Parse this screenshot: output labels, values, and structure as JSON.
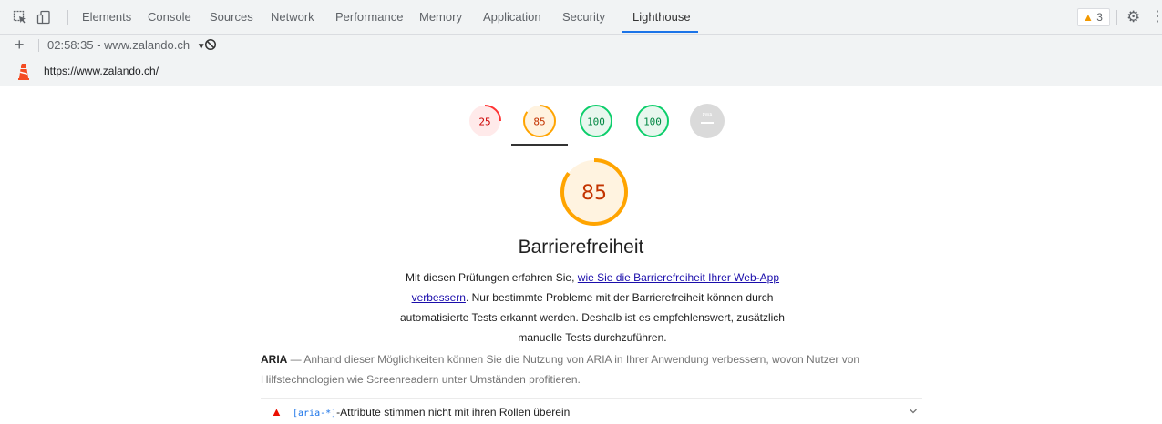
{
  "devtools": {
    "tabs": [
      "Elements",
      "Console",
      "Sources",
      "Network",
      "Performance",
      "Memory",
      "Application",
      "Security",
      "Lighthouse"
    ],
    "active_tab": "Lighthouse",
    "warning_count": "3",
    "icons": [
      "inspect-element-icon",
      "device-toolbar-icon",
      "warning-icon",
      "gear-icon",
      "kebab-menu-icon"
    ]
  },
  "report_bar": {
    "selected_report": "02:58:35 - www.zalando.ch",
    "icons": [
      "plus-icon",
      "dropdown-caret-icon",
      "clear-block-icon"
    ]
  },
  "url_bar": {
    "url": "https://www.zalando.ch/",
    "icon": "lighthouse-icon"
  },
  "scores": [
    {
      "value": "25",
      "status": "fail",
      "color": "#ff3333"
    },
    {
      "value": "85",
      "status": "average",
      "color": "#ffa400",
      "selected": true
    },
    {
      "value": "100",
      "status": "pass",
      "color": "#0cce6b"
    },
    {
      "value": "100",
      "status": "pass",
      "color": "#0cce6b"
    },
    {
      "value": "PWA",
      "status": "na",
      "color": "#bdbdbd"
    }
  ],
  "category": {
    "score": "85",
    "score_fraction": 0.85,
    "title": "Barrierefreiheit",
    "desc_before": "Mit diesen Prüfungen erfahren Sie, ",
    "desc_link": "wie Sie die Barrierefreiheit Ihrer Web-App verbessern",
    "desc_after": ". Nur bestimmte Probleme mit der Barrierefreiheit können durch automatisierte Tests erkannt werden. Deshalb ist es empfehlenswert, zusätzlich manuelle Tests durchzuführen."
  },
  "group": {
    "title": "ARIA",
    "description": " — Anhand dieser Möglichkeiten können Sie die Nutzung von ARIA in Ihrer Anwendung verbessern, wovon Nutzer von Hilfstechnologien wie Screenreadern unter Umständen profitieren."
  },
  "audit": {
    "code": "[aria-*]",
    "text": "-Attribute stimmen nicht mit ihren Rollen überein",
    "status": "fail",
    "icon": "chevron-down-icon"
  },
  "colors": {
    "fail": "#ff3333",
    "average": "#ffa400",
    "pass": "#0cce6b",
    "link": "#1a0dab",
    "accent": "#1a73e8"
  }
}
